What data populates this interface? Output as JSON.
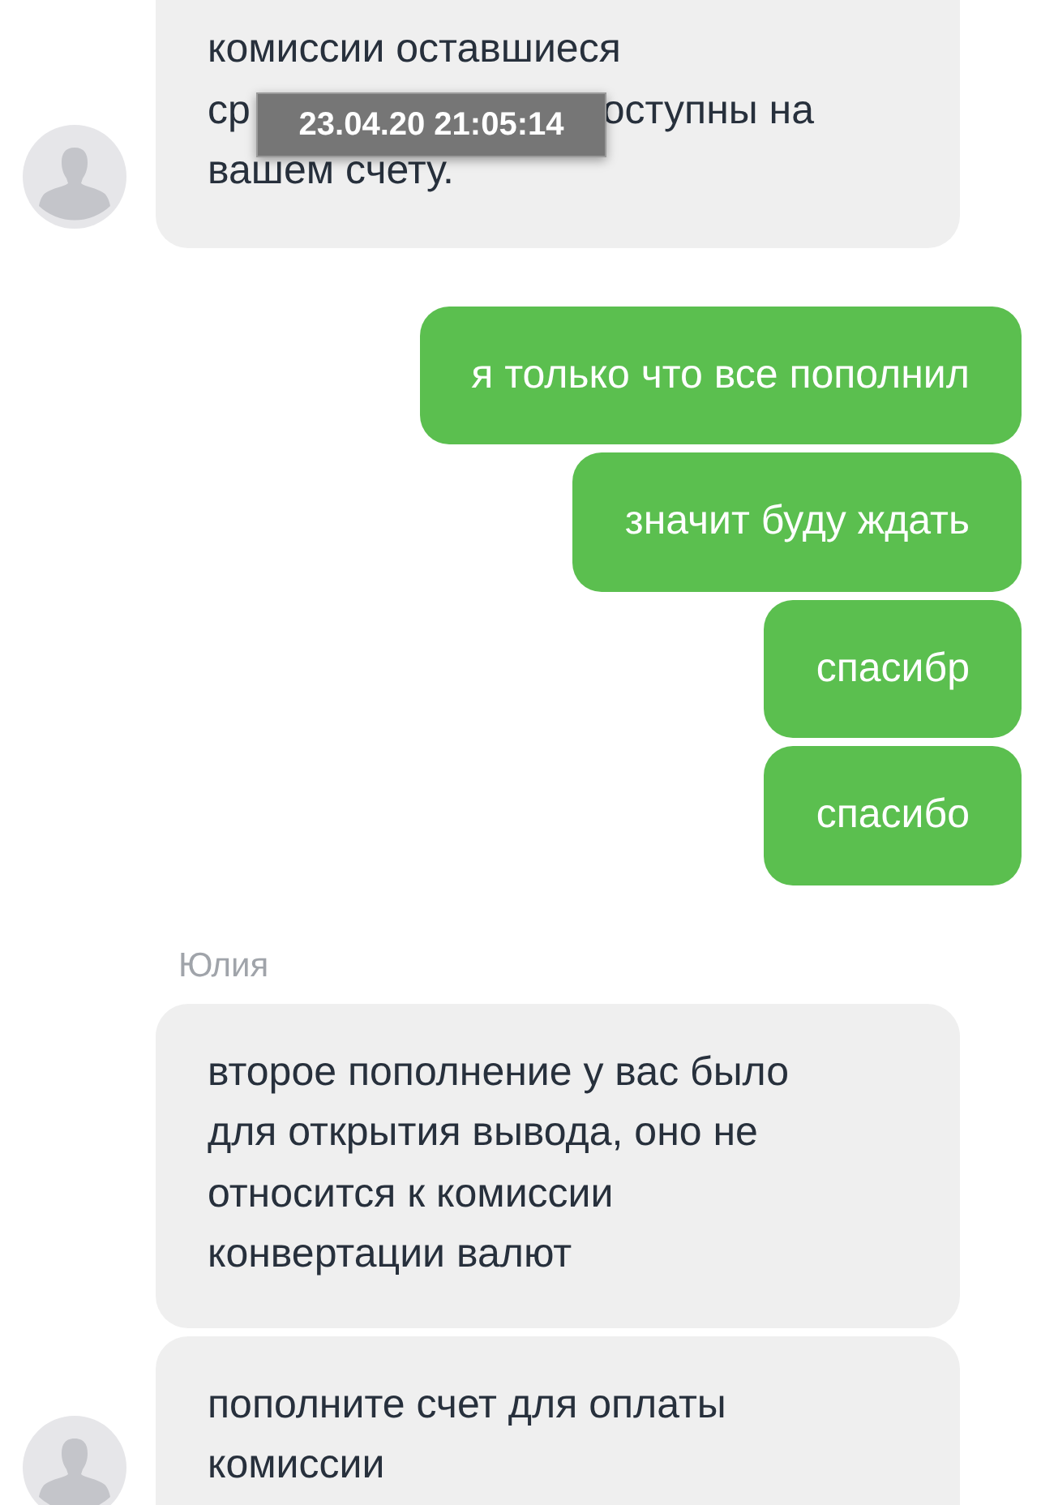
{
  "messages": [
    {
      "kind": "incoming",
      "avatar": true,
      "tooltip": "23.04.20 21:05:14",
      "lines": [
        {
          "parts": [
            "комиссии оставшиеся"
          ]
        },
        {
          "parts": [
            "ср",
            "оступны на"
          ]
        },
        {
          "parts": [
            "вашем счету."
          ]
        }
      ]
    },
    {
      "kind": "outgoing",
      "text": "я только что все пополнил"
    },
    {
      "kind": "outgoing",
      "text": "значит буду ждать"
    },
    {
      "kind": "outgoing",
      "text": "спасибр"
    },
    {
      "kind": "outgoing",
      "text": "спасибо"
    },
    {
      "kind": "sender",
      "text": "Юлия"
    },
    {
      "kind": "incoming",
      "avatar": false,
      "lines": [
        {
          "parts": [
            "второе пополнение у вас было"
          ]
        },
        {
          "parts": [
            "для открытия вывода, оно не"
          ]
        },
        {
          "parts": [
            "относится к комиссии"
          ]
        },
        {
          "parts": [
            "конвертации валют"
          ]
        }
      ]
    },
    {
      "kind": "incoming",
      "avatar": true,
      "lines": [
        {
          "parts": [
            "пополните счет для оплаты"
          ]
        },
        {
          "parts": [
            "комиссии"
          ]
        }
      ]
    }
  ]
}
